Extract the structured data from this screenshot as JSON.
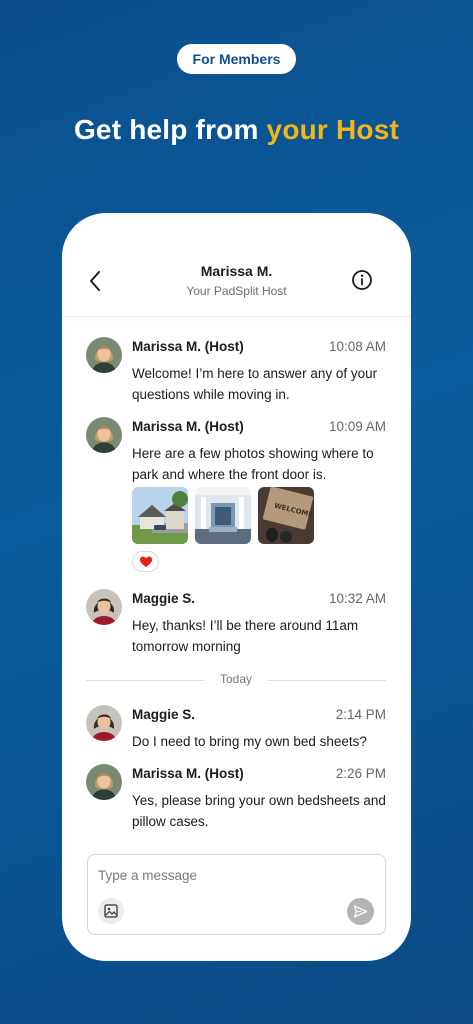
{
  "promo": {
    "badge": "For Members",
    "headline_start": "Get help from ",
    "headline_accent": "your Host"
  },
  "colors": {
    "background": "#0b4f8c",
    "accent": "#f4b41a",
    "reaction": "#e0261b"
  },
  "chat_header": {
    "name": "Marissa M.",
    "subtitle": "Your PadSplit Host",
    "back_icon": "chevron-left-icon",
    "info_icon": "info-circle-icon"
  },
  "messages": [
    {
      "sender": "Marissa M. (Host)",
      "time": "10:08 AM",
      "text": "Welcome! I’m here to answer any of your questions while moving in."
    },
    {
      "sender": "Marissa M. (Host)",
      "time": "10:09 AM",
      "text": "Here are a few photos showing where to park and where the front door is.",
      "photos": [
        "house-exterior-photo",
        "front-porch-photo",
        "welcome-doormat-photo"
      ],
      "reaction": "❤️"
    },
    {
      "sender": "Maggie S.",
      "time": "10:32 AM",
      "text": "Hey, thanks! I’ll be there around 11am tomorrow morning"
    },
    {
      "sender": "Maggie S.",
      "time": "2:14 PM",
      "text": "Do I need to bring my own bed sheets?"
    },
    {
      "sender": "Marissa M. (Host)",
      "time": "2:26 PM",
      "text": "Yes, please bring your own bedsheets and pillow cases."
    }
  ],
  "date_divider": "Today",
  "composer": {
    "placeholder": "Type a message",
    "image_icon": "image-icon",
    "send_icon": "send-icon"
  }
}
